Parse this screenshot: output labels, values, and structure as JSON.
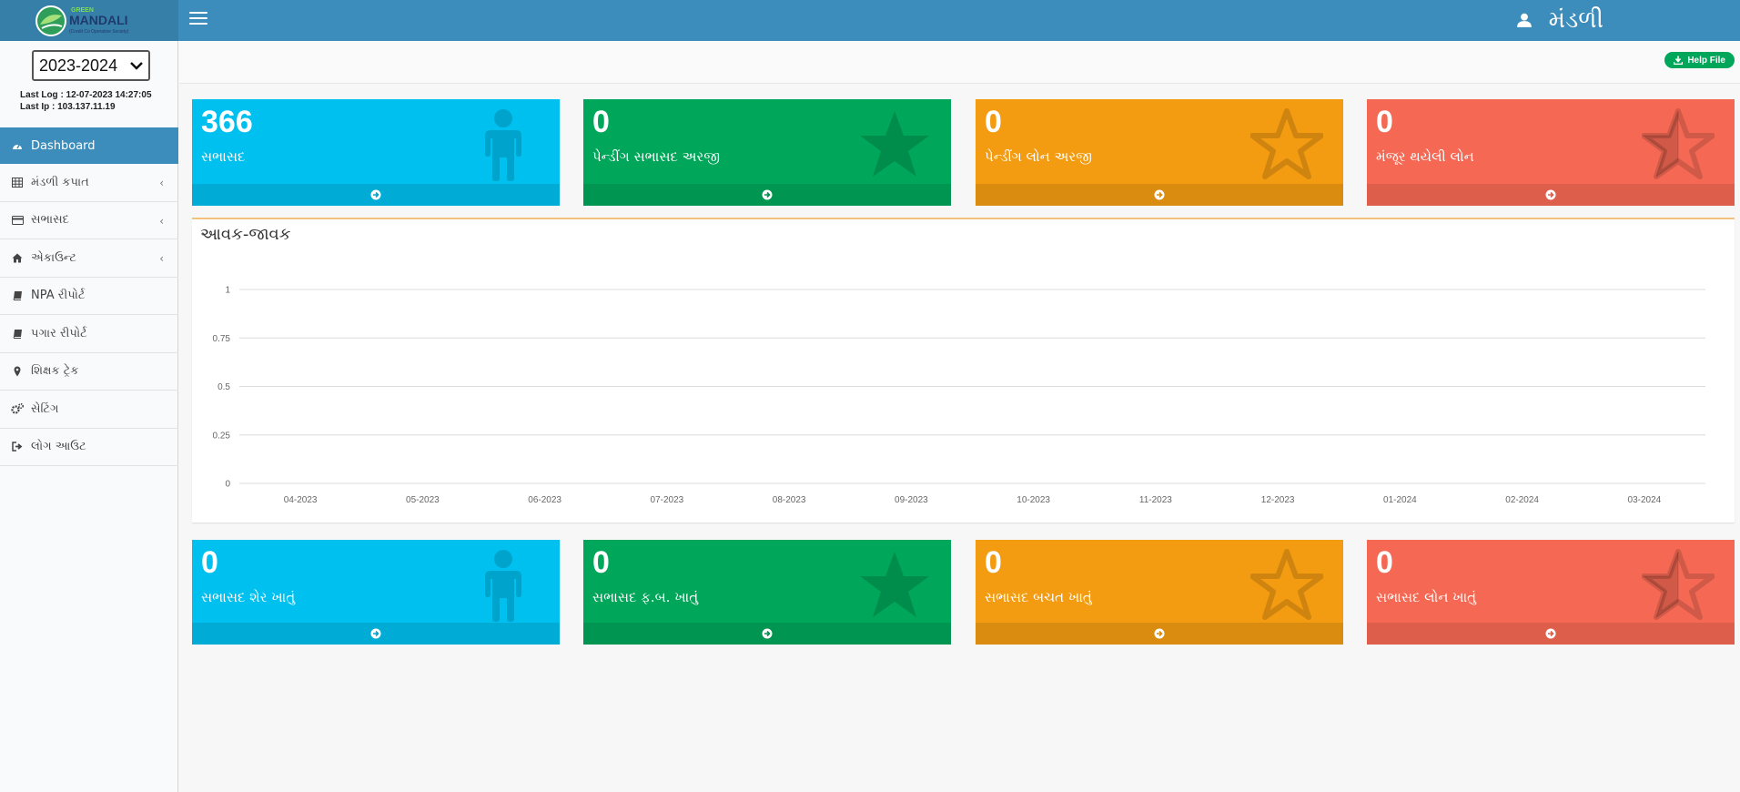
{
  "app": {
    "logo_small": "GREEN",
    "logo_main": "MANDALI",
    "logo_sub": "(Credit Co Operative Society)",
    "user_name": "મંડળી",
    "header_bg": "#3c8dbc"
  },
  "sidebar": {
    "year": "2023-2024",
    "last_log": "Last Log : 12-07-2023 14:27:05",
    "last_ip": "Last Ip : 103.137.11.19",
    "items": [
      {
        "label": "Dashboard",
        "icon": "dashboard-icon"
      },
      {
        "label": "મંડળી કપાત",
        "icon": "table-icon"
      },
      {
        "label": "સભાસદ",
        "icon": "card-icon"
      },
      {
        "label": "એકાઉન્ટ",
        "icon": "home-icon"
      },
      {
        "label": "NPA રીપોર્ટ",
        "icon": "book-icon"
      },
      {
        "label": "પગાર રીપોર્ટ",
        "icon": "book-icon"
      },
      {
        "label": "શિક્ષક ટ્રેક",
        "icon": "map-marker-icon"
      },
      {
        "label": "સેટિંગ",
        "icon": "cogs-icon"
      },
      {
        "label": "લોગ આઉટ",
        "icon": "sign-out-icon"
      }
    ]
  },
  "help_button": "Help File",
  "top_boxes": [
    {
      "value": "366",
      "label": "સભાસદ",
      "color": "#00c0ef",
      "icon": "person-icon"
    },
    {
      "value": "0",
      "label": "પેન્ડીંગ સભાસદ અરજી",
      "color": "#00a65a",
      "icon": "star-icon"
    },
    {
      "value": "0",
      "label": "પેન્ડીંગ લોન અરજી",
      "color": "#f39c12",
      "icon": "star-outline-icon"
    },
    {
      "value": "0",
      "label": "મંજૂર થયેલી લોન",
      "color": "#f56954",
      "icon": "star-half-icon"
    }
  ],
  "bottom_boxes": [
    {
      "value": "0",
      "label": "સભાસદ શેર ખાતું",
      "color": "#00c0ef",
      "icon": "person-icon"
    },
    {
      "value": "0",
      "label": "સભાસદ ફ.બ. ખાતું",
      "color": "#00a65a",
      "icon": "star-icon"
    },
    {
      "value": "0",
      "label": "સભાસદ બચત ખાતું",
      "color": "#f39c12",
      "icon": "star-outline-icon"
    },
    {
      "value": "0",
      "label": "સભાસદ લોન ખાતું",
      "color": "#f56954",
      "icon": "star-half-icon"
    }
  ],
  "chart_data": {
    "type": "line",
    "title": "આવક-જાવક",
    "xlabel": "",
    "ylabel": "",
    "categories": [
      "04-2023",
      "05-2023",
      "06-2023",
      "07-2023",
      "08-2023",
      "09-2023",
      "10-2023",
      "11-2023",
      "12-2023",
      "01-2024",
      "02-2024",
      "03-2024"
    ],
    "y_ticks": [
      "0",
      "0.25",
      "0.5",
      "0.75",
      "1"
    ],
    "ylim": [
      0,
      1
    ],
    "grid": true,
    "series": []
  }
}
